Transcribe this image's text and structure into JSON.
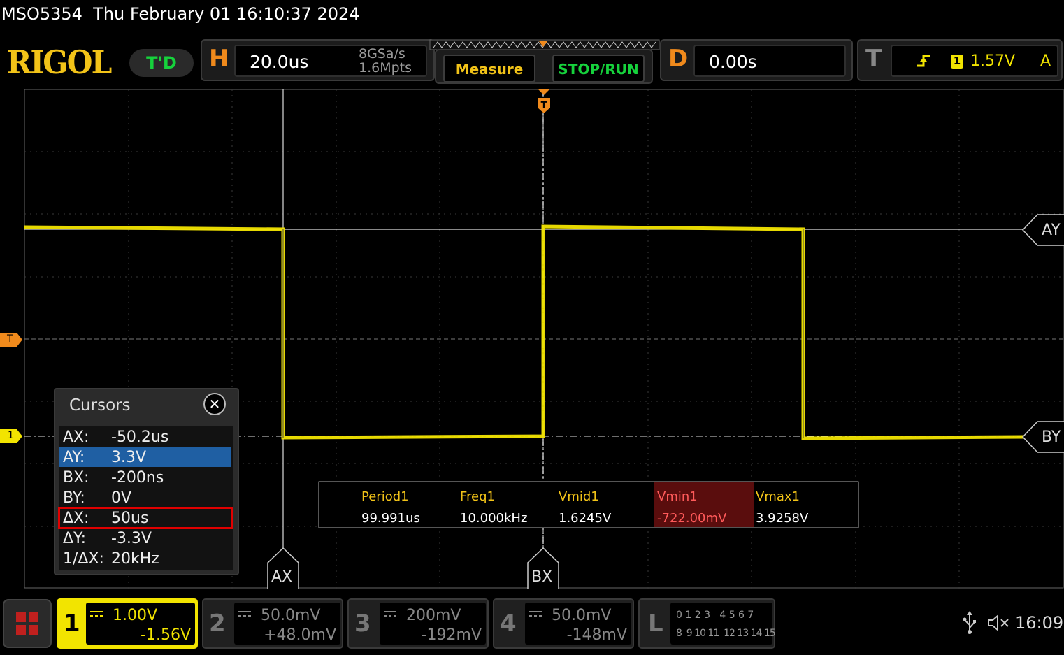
{
  "title": "MSO5354  Thu February 01 16:10:37 2024",
  "logo": "RIGOL",
  "trigger_mode": "T'D",
  "horizontal": {
    "letter": "H",
    "timebase": "20.0us",
    "sample_rate": "8GSa/s",
    "memory_depth": "1.6Mpts"
  },
  "buttons": {
    "measure": "Measure",
    "stop_run": "STOP/RUN"
  },
  "delay": {
    "letter": "D",
    "value": "0.00s"
  },
  "trigger": {
    "letter": "T",
    "channel": "1",
    "level": "1.57V",
    "mode": "A"
  },
  "markers": {
    "trig_position": "T",
    "trig_level": "T",
    "ch1": "1",
    "ay": "AY",
    "by": "BY",
    "ax": "AX",
    "bx": "BX"
  },
  "cursors": {
    "title": "Cursors",
    "close": "✕",
    "rows": [
      {
        "key": "AX:",
        "value": "-50.2us"
      },
      {
        "key": "AY:",
        "value": "3.3V"
      },
      {
        "key": "BX:",
        "value": "-200ns"
      },
      {
        "key": "BY:",
        "value": "0V"
      },
      {
        "key": "ΔX:",
        "value": "50us"
      },
      {
        "key": "ΔY:",
        "value": "-3.3V"
      },
      {
        "key": "1/ΔX:",
        "value": "20kHz"
      }
    ]
  },
  "measurements": [
    {
      "name": "Period1",
      "value": "99.991us"
    },
    {
      "name": "Freq1",
      "value": "10.000kHz"
    },
    {
      "name": "Vmid1",
      "value": "1.6245V"
    },
    {
      "name": "Vmin1",
      "value": "-722.00mV"
    },
    {
      "name": "Vmax1",
      "value": "3.9258V"
    }
  ],
  "channels": [
    {
      "num": "1",
      "scale": "1.00V",
      "offset": "-1.56V",
      "color": "#f2e400"
    },
    {
      "num": "2",
      "scale": "50.0mV",
      "offset": "+48.0mV",
      "color": "#777777"
    },
    {
      "num": "3",
      "scale": "200mV",
      "offset": "-192mV",
      "color": "#777777"
    },
    {
      "num": "4",
      "scale": "50.0mV",
      "offset": "-148mV",
      "color": "#777777"
    }
  ],
  "logic": {
    "letter": "L",
    "row1": "0 1 2 3   4 5 6 7",
    "row2": "8  9 10 11  12 13 14 15"
  },
  "status": {
    "time": "16:09",
    "usb_icon": "usb-icon",
    "speaker_icon": "speaker-muted-icon"
  },
  "colors": {
    "ch1": "#f2e400",
    "orange": "#f08a1c",
    "green": "#16d23c",
    "brand": "#f2c318",
    "highlight": "#e00000"
  }
}
